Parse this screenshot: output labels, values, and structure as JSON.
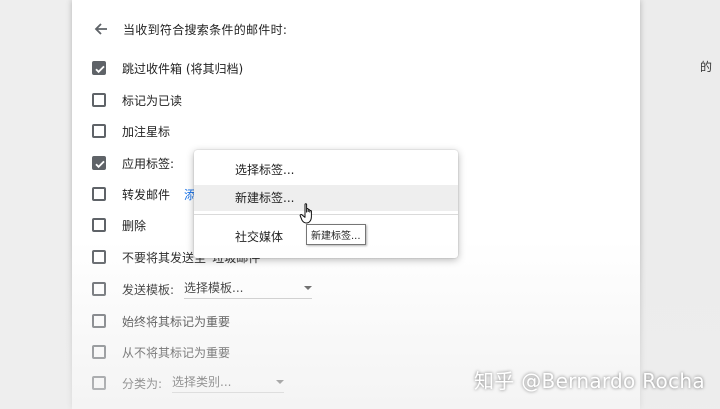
{
  "header": {
    "title": "当收到符合搜索条件的邮件时:"
  },
  "side_clip": "的",
  "actions": [
    {
      "label": "跳过收件箱 (将其归档)",
      "checked": true
    },
    {
      "label": "标记为已读",
      "checked": false
    },
    {
      "label": "加注星标",
      "checked": false
    },
    {
      "label": "应用标签:",
      "checked": true
    },
    {
      "label": "转发邮件",
      "checked": false,
      "link": "添"
    },
    {
      "label": "删除",
      "checked": false
    },
    {
      "label": "不要将其发送至“垃圾邮件”",
      "checked": false
    },
    {
      "label": "发送模板:",
      "checked": false,
      "select": "选择模板..."
    },
    {
      "label": "始终将其标记为重要",
      "checked": false
    },
    {
      "label": "从不将其标记为重要",
      "checked": false
    },
    {
      "label": "分类为:",
      "checked": false,
      "select": "选择类别..."
    }
  ],
  "label_menu": {
    "items": [
      "选择标签...",
      "新建标签...",
      "社交媒体"
    ],
    "hovered": "新建标签..."
  },
  "tooltip": "新建标签...",
  "watermark": "知乎 @Bernardo Rocha",
  "colors": {
    "link": "#1a73e8",
    "checkbox": "#5f6368",
    "hover": "#eeeeee"
  }
}
